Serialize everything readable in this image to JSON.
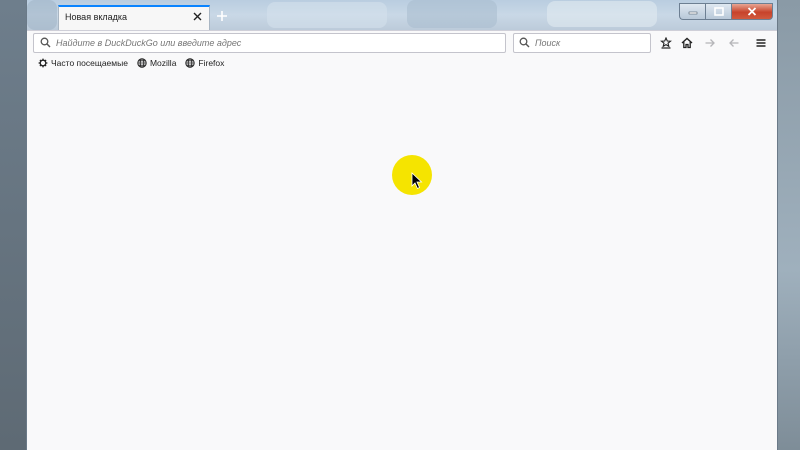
{
  "browser": {
    "tab": {
      "title": "Новая вкладка"
    },
    "urlbar": {
      "placeholder": "Найдите в DuckDuckGo или введите адрес"
    },
    "searchbar": {
      "placeholder": "Поиск"
    }
  },
  "bookmarks": [
    {
      "label": "Часто посещаемые",
      "icon": "gear-icon"
    },
    {
      "label": "Mozilla",
      "icon": "globe-icon"
    },
    {
      "label": "Firefox",
      "icon": "globe-icon"
    }
  ],
  "colors": {
    "tab_accent": "#0a84ff",
    "content_bg": "#f9f9fa",
    "click_highlight": "#f5e400"
  }
}
